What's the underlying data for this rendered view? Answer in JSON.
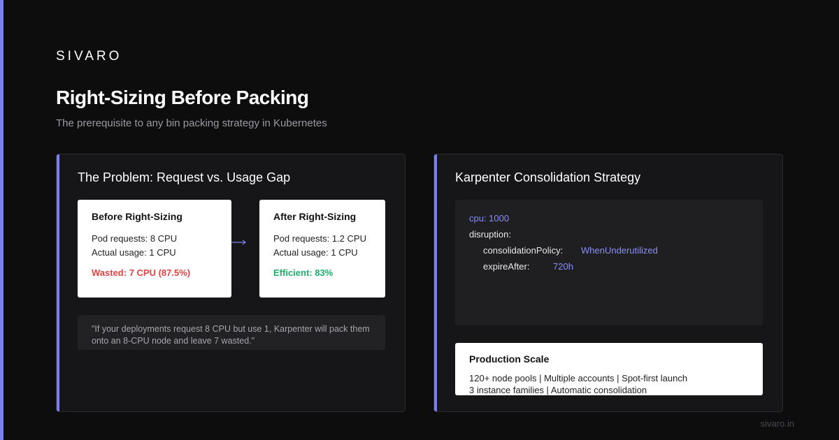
{
  "brand": "SIVARO",
  "title": "Right-Sizing Before Packing",
  "subtitle": "The prerequisite to any bin packing strategy in Kubernetes",
  "colors": {
    "accent": "#7b7ff0",
    "wasted": "#e24343",
    "efficient": "#1fae6c",
    "background": "#0d0d0e"
  },
  "left_panel": {
    "title": "The Problem: Request vs. Usage Gap",
    "before": {
      "heading": "Before Right-Sizing",
      "requests": "Pod requests: 8 CPU",
      "usage": "Actual usage: 1 CPU",
      "status": "Wasted: 7 CPU (87.5%)"
    },
    "arrow_icon": "arrow-right-icon",
    "after": {
      "heading": "After Right-Sizing",
      "requests": "Pod requests: 1.2 CPU",
      "usage": "Actual usage: 1 CPU",
      "status": "Efficient: 83%"
    },
    "quote": "\"If your deployments request 8 CPU but use 1, Karpenter will pack them onto an 8-CPU node and leave 7 wasted.\""
  },
  "right_panel": {
    "title": "Karpenter Consolidation Strategy",
    "code": {
      "cpu_line": "cpu: 1000",
      "disruption_key": "disruption:",
      "policy_key": "consolidationPolicy:",
      "policy_value": "WhenUnderutilized",
      "expire_key": "expireAfter:",
      "expire_value": "720h"
    },
    "scale": {
      "heading": "Production Scale",
      "line1": "120+ node pools | Multiple accounts | Spot-first launch",
      "line2": "3 instance families | Automatic consolidation"
    }
  },
  "footer": "sivaro.in"
}
